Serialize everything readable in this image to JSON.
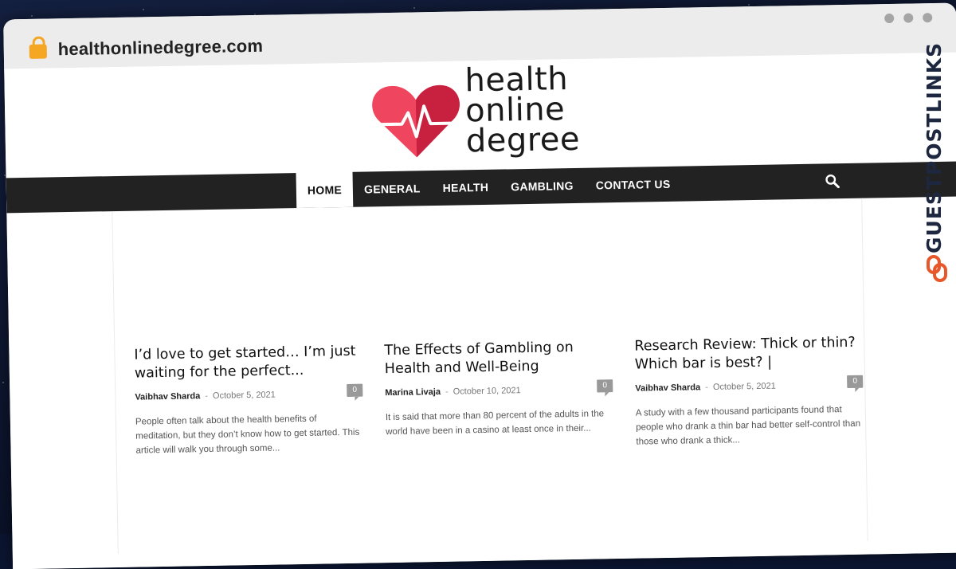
{
  "browser": {
    "url": "healthonlinedegree.com"
  },
  "logo": {
    "line1": "health",
    "line2": "online",
    "line3": "degree"
  },
  "nav": {
    "items": [
      "HOME",
      "GENERAL",
      "HEALTH",
      "GAMBLING",
      "CONTACT US"
    ],
    "active": "HOME"
  },
  "posts": [
    {
      "title": "I’d love to get started… I’m just waiting for the perfect...",
      "author": "Vaibhav Sharda",
      "date": "October 5, 2021",
      "comments": "0",
      "excerpt": "People often talk about the health benefits of meditation, but they don’t know how to get started. This article will walk you through some..."
    },
    {
      "title": "The Effects of Gambling on Health and Well-Being",
      "author": "Marina Livaja",
      "date": "October 10, 2021",
      "comments": "0",
      "excerpt": "It is said that more than 80 percent of the adults in the world have been in a casino at least once in their..."
    },
    {
      "title": "Research Review: Thick or thin? Which bar is best? |",
      "author": "Vaibhav Sharda",
      "date": "October 5, 2021",
      "comments": "0",
      "excerpt": "A study with a few thousand participants found that people who drank a thin bar had better self-control than those who drank a thick..."
    }
  ],
  "watermark": {
    "text": "GUESTPOSTLINKS"
  },
  "colors": {
    "heart_light": "#f0455f",
    "heart_dark": "#c8203f",
    "nav_bg": "#222222",
    "watermark_accent": "#e8572a"
  },
  "icons": {
    "lock": "lock-icon",
    "search": "search-icon",
    "chain": "chain-link-icon"
  }
}
